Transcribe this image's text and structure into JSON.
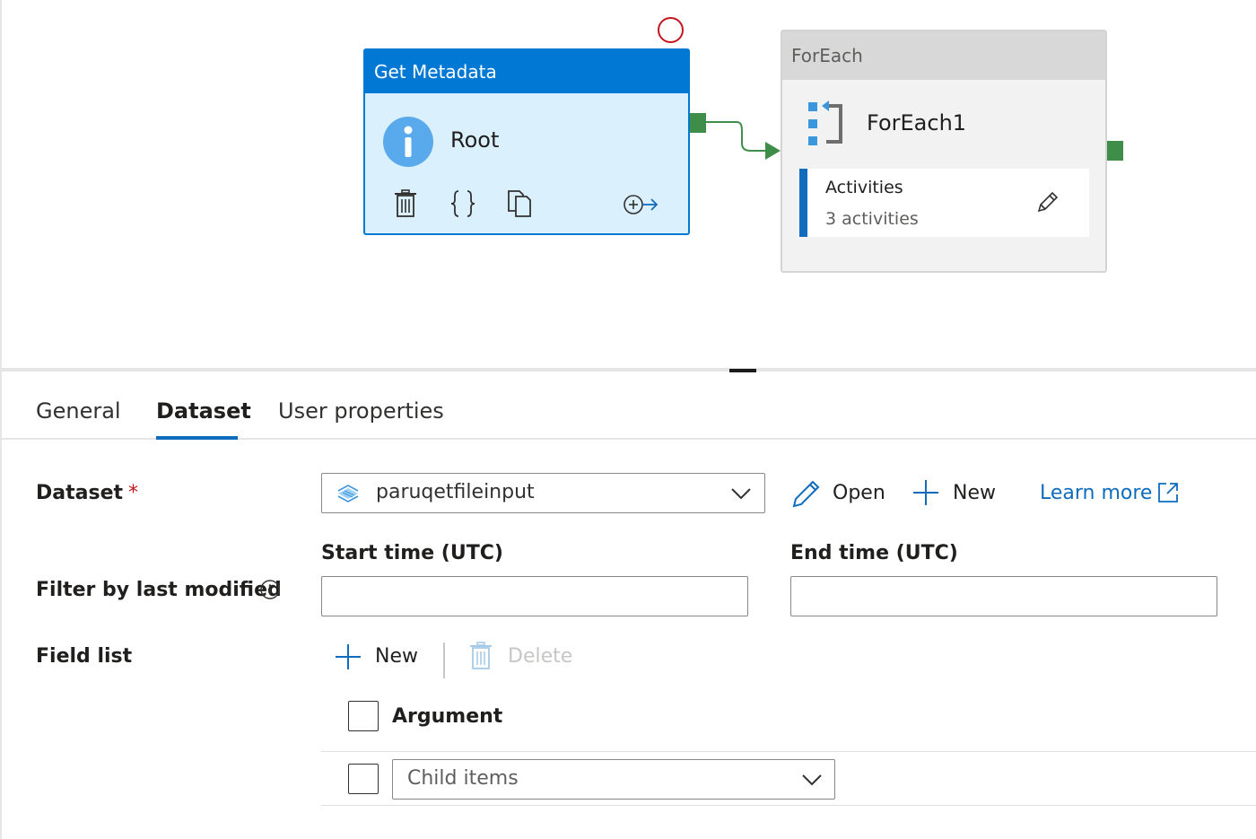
{
  "canvas": {
    "get_metadata": {
      "type_label": "Get Metadata",
      "name": "Root"
    },
    "foreach": {
      "type_label": "ForEach",
      "name": "ForEach1",
      "activities_label": "Activities",
      "activities_count": "3 activities"
    }
  },
  "tabs": {
    "general": "General",
    "dataset": "Dataset",
    "user_properties": "User properties",
    "active": "Dataset"
  },
  "form": {
    "dataset_label": "Dataset",
    "required_mark": "*",
    "dataset_value": "paruqetfileinput",
    "open_label": "Open",
    "new_label": "New",
    "learn_more_label": "Learn more",
    "filter_label": "Filter by last modified",
    "start_time_label": "Start time (UTC)",
    "end_time_label": "End time (UTC)",
    "start_time_value": "",
    "end_time_value": "",
    "field_list_label": "Field list",
    "field_new_label": "New",
    "field_delete_label": "Delete",
    "argument_header": "Argument",
    "field_rows": [
      {
        "value": "Child items"
      }
    ]
  },
  "colors": {
    "accent": "#0078d4",
    "link": "#0f6cbd",
    "success_port": "#3e8e4a",
    "error_ring": "#c4161c"
  }
}
